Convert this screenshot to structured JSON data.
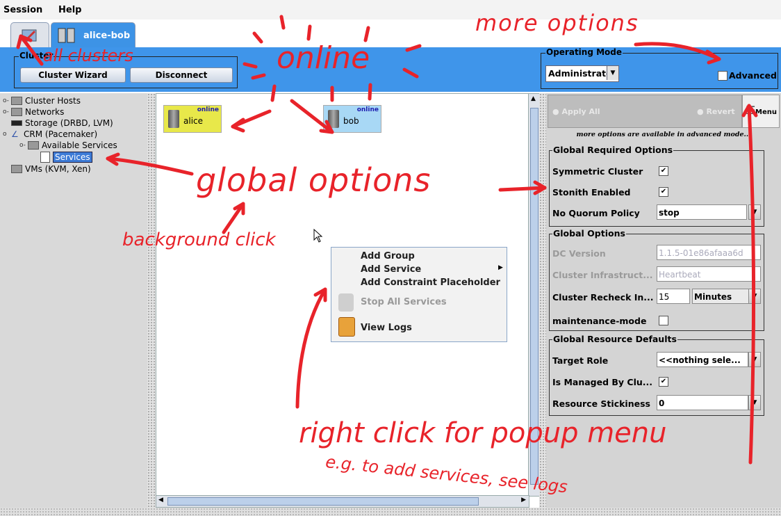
{
  "menubar": {
    "session": "Session",
    "help": "Help"
  },
  "tabs": {
    "cluster_tab": "alice-bob"
  },
  "cluster_group": {
    "legend": "Cluster",
    "wizard": "Cluster Wizard",
    "disconnect": "Disconnect"
  },
  "operating_mode": {
    "legend": "Operating Mode",
    "value": "Administrator",
    "advanced": "Advanced"
  },
  "tree": {
    "items": [
      "Cluster Hosts",
      "Networks",
      "Storage (DRBD, LVM)",
      "CRM (Pacemaker)",
      "Available Services",
      "Services",
      "VMs (KVM, Xen)"
    ]
  },
  "hosts": [
    {
      "name": "alice",
      "status": "online",
      "color": "#e8e84a"
    },
    {
      "name": "bob",
      "status": "online",
      "color": "#a8d8f5"
    }
  ],
  "popup": {
    "add_group": "Add Group",
    "add_service": "Add Service",
    "add_constraint": "Add Constraint Placeholder",
    "stop_all": "Stop All Services",
    "view_logs": "View Logs"
  },
  "toolbar": {
    "apply_all": "Apply All",
    "revert": "Revert",
    "menu": "Menu"
  },
  "advanced_note": "more options are available in advanced mode...",
  "global_required": {
    "legend": "Global Required Options",
    "symmetric_cluster": "Symmetric Cluster",
    "stonith_enabled": "Stonith Enabled",
    "no_quorum_policy": "No Quorum Policy",
    "no_quorum_value": "stop"
  },
  "global_options": {
    "legend": "Global Options",
    "dc_version": "DC Version",
    "dc_version_value": "1.1.5-01e86afaaa6d",
    "cluster_infra": "Cluster Infrastruct...",
    "cluster_infra_value": "Heartbeat",
    "recheck": "Cluster Recheck In...",
    "recheck_value": "15",
    "recheck_unit": "Minutes",
    "maintenance": "maintenance-mode"
  },
  "global_defaults": {
    "legend": "Global Resource Defaults",
    "target_role": "Target Role",
    "target_role_value": "<<nothing sele...",
    "is_managed": "Is Managed By Clu...",
    "stickiness": "Resource Stickiness",
    "stickiness_value": "0"
  },
  "annotations": {
    "all_clusters": "all clusters",
    "more_options": "more options",
    "online": "online",
    "global_options": "global options",
    "background_click": "background click",
    "right_click": "right click for popup menu",
    "eg": "e.g. to add services, see logs"
  },
  "colors": {
    "band": "#3f95ea",
    "annotation": "#e8232a"
  }
}
